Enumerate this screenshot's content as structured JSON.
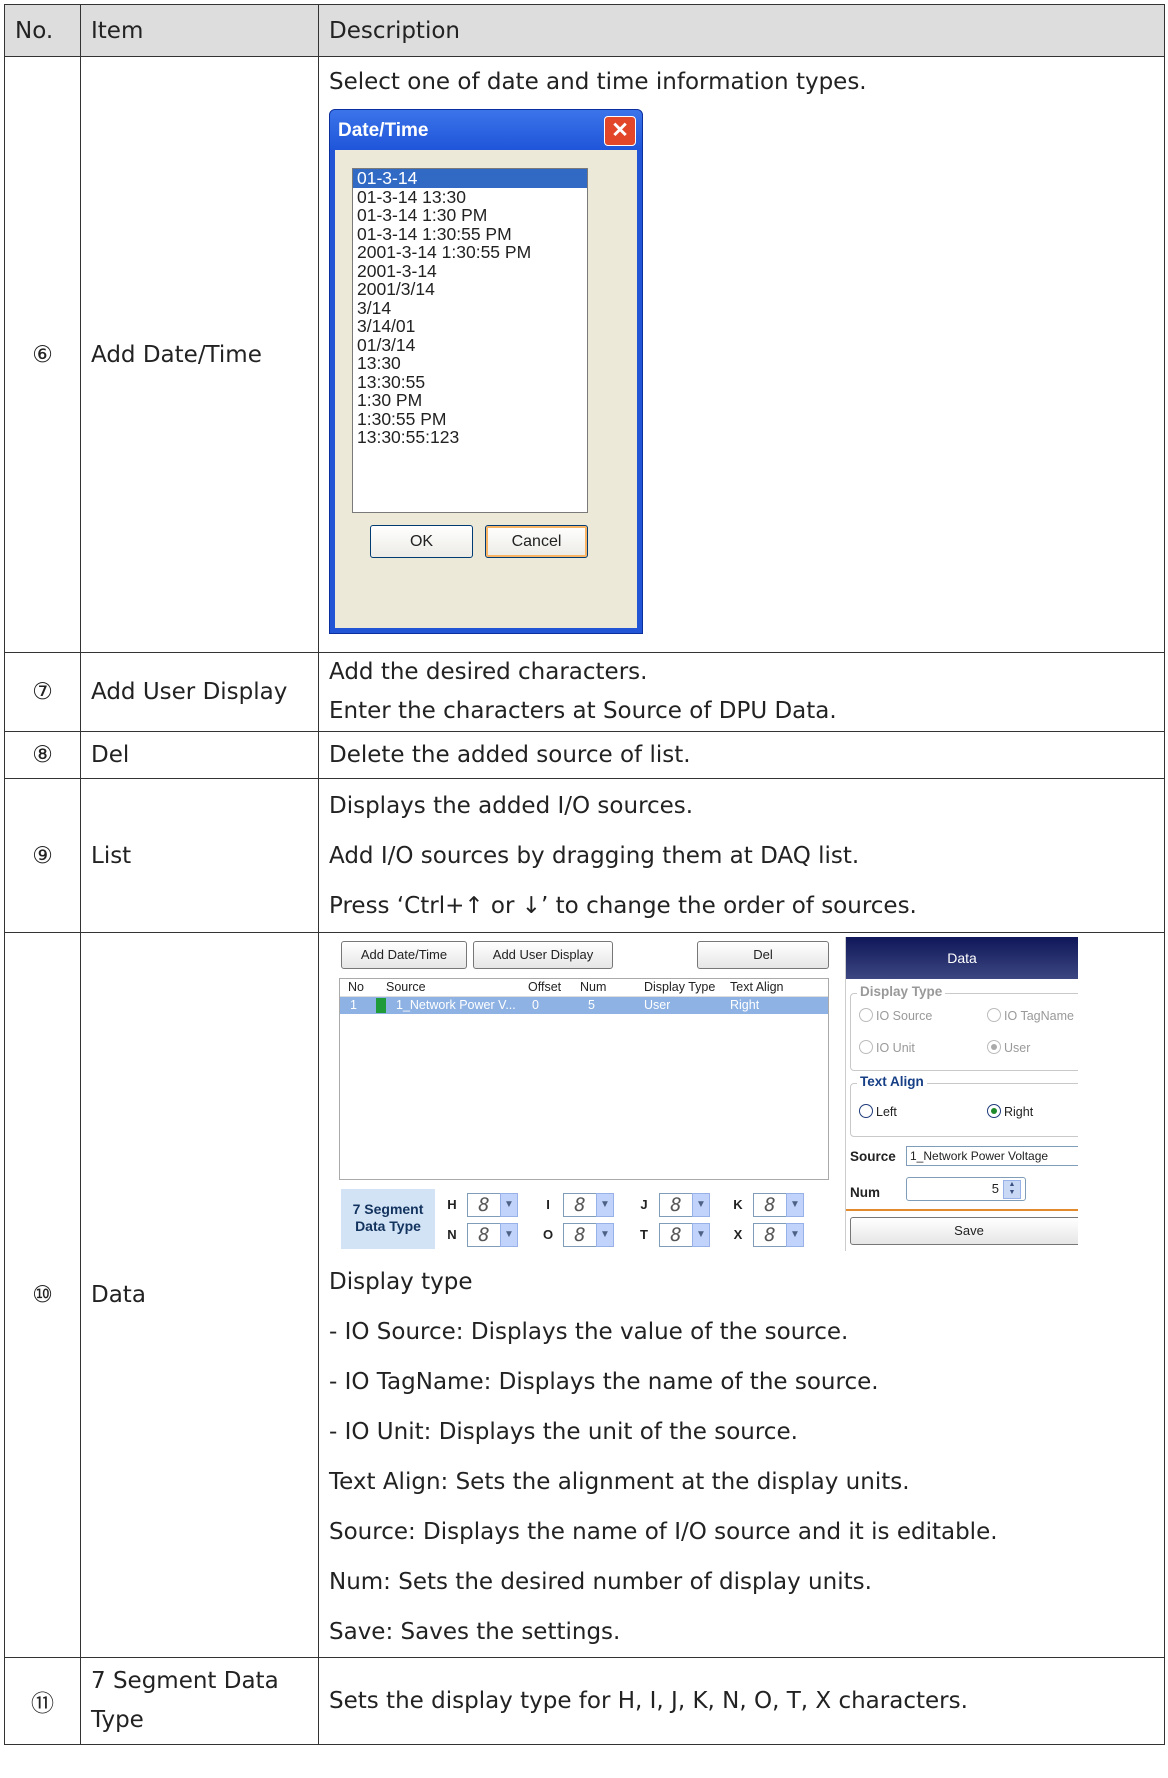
{
  "header": {
    "no": "No.",
    "item": "Item",
    "description": "Description"
  },
  "rows": {
    "r6": {
      "no": "⑥",
      "item": "Add Date/Time",
      "desc": "Select one of date and time information types."
    },
    "r7": {
      "no": "⑦",
      "item": "Add User Display",
      "desc": [
        "Add the desired characters.",
        "Enter the characters at Source of DPU Data."
      ]
    },
    "r8": {
      "no": "⑧",
      "item": "Del",
      "desc": "Delete the added source of list."
    },
    "r9": {
      "no": "⑨",
      "item": "List",
      "desc": [
        "Displays the added I/O sources.",
        "Add I/O sources by dragging them at DAQ list.",
        "Press ‘Ctrl+↑  or  ↓’ to change the order of sources."
      ]
    },
    "r10": {
      "no": "⑩",
      "item": "Data",
      "desc": [
        "Display type",
        "- IO Source: Displays the value of the source.",
        "- IO TagName: Displays the name of the source.",
        "- IO Unit: Displays the unit of the source.",
        "Text Align: Sets the alignment at the display units.",
        "Source: Displays the name of I/O source and it is editable.",
        "Num: Sets the desired number of display units.",
        "Save: Saves the settings."
      ]
    },
    "r11": {
      "no": "⑪",
      "item": "7 Segment Data Type",
      "desc": "Sets the display type for H, I, J, K, N, O, T, X characters."
    }
  },
  "date_dialog": {
    "title": "Date/Time",
    "close_glyph": "✕",
    "formats": [
      "01-3-14",
      "01-3-14 13:30",
      "01-3-14 1:30 PM",
      "01-3-14 1:30:55 PM",
      "2001-3-14 1:30:55 PM",
      "2001-3-14",
      "2001/3/14",
      "3/14",
      "3/14/01",
      "01/3/14",
      "13:30",
      "13:30:55",
      "1:30 PM",
      "1:30:55 PM",
      "13:30:55:123"
    ],
    "selected_index": 0,
    "ok": "OK",
    "cancel": "Cancel"
  },
  "data_screen": {
    "add_datetime": "Add Date/Time",
    "add_user_display": "Add User Display",
    "del": "Del",
    "columns": {
      "no": "No",
      "source": "Source",
      "offset": "Offset",
      "num": "Num",
      "display_type": "Display Type",
      "text_align": "Text Align"
    },
    "row": {
      "no": "1",
      "source": "1_Network Power V...",
      "offset": "0",
      "num": "5",
      "display_type": "User",
      "text_align": "Right"
    },
    "seg_label": "7 Segment Data Type",
    "segments": [
      {
        "l": "H",
        "g": "8"
      },
      {
        "l": "I",
        "g": "8"
      },
      {
        "l": "J",
        "g": "8"
      },
      {
        "l": "K",
        "g": "8"
      },
      {
        "l": "N",
        "g": "8"
      },
      {
        "l": "O",
        "g": "8"
      },
      {
        "l": "T",
        "g": "8"
      },
      {
        "l": "X",
        "g": "8"
      }
    ],
    "panel": {
      "title": "Data",
      "display_type": "Display Type",
      "io_source": "IO Source",
      "io_tagname": "IO TagName",
      "io_unit": "IO Unit",
      "user": "User",
      "text_align": "Text Align",
      "left": "Left",
      "right": "Right",
      "source_label": "Source",
      "source_value": "1_Network Power Voltage",
      "num_label": "Num",
      "num_value": "5",
      "save": "Save"
    }
  }
}
